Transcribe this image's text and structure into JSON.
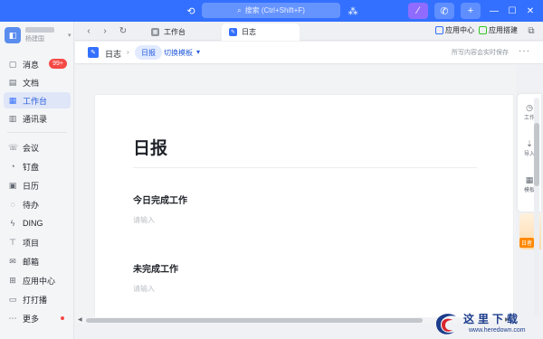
{
  "titlebar": {
    "search_placeholder": "搜索 (Ctrl+Shift+F)",
    "accent": "#3370ff",
    "icons": [
      "history-icon",
      "search-icon",
      "grid-apps-icon",
      "wand-icon",
      "phone-icon",
      "plus-icon",
      "minimize-icon",
      "maximize-icon",
      "close-icon"
    ]
  },
  "sidebar": {
    "user": {
      "org": "杨建国"
    },
    "items": [
      {
        "label": "消息",
        "icon": "chat-icon",
        "badge": "99+"
      },
      {
        "label": "文档",
        "icon": "document-icon"
      },
      {
        "label": "工作台",
        "icon": "workbench-icon",
        "active": true
      },
      {
        "label": "通讯录",
        "icon": "contacts-icon"
      },
      {
        "label": "会议",
        "icon": "meeting-icon"
      },
      {
        "label": "钉盘",
        "icon": "drive-icon"
      },
      {
        "label": "日历",
        "icon": "calendar-icon"
      },
      {
        "label": "待办",
        "icon": "todo-icon"
      },
      {
        "label": "DING",
        "icon": "ding-icon"
      },
      {
        "label": "项目",
        "icon": "project-icon"
      },
      {
        "label": "邮箱",
        "icon": "mail-icon"
      },
      {
        "label": "应用中心",
        "icon": "app-center-icon"
      },
      {
        "label": "打打播",
        "icon": "broadcast-icon"
      },
      {
        "label": "更多",
        "icon": "more-icon",
        "dot": true
      }
    ]
  },
  "tabs": [
    {
      "label": "工作台",
      "active": false
    },
    {
      "label": "日志",
      "active": true
    }
  ],
  "tabbar_right": {
    "app_center": "应用中心",
    "app_build": "应用搭建"
  },
  "doc": {
    "breadcrumb": "日志",
    "chip": "日报",
    "template_switch": "切换模板",
    "autosave": "所写内容会实时保存",
    "more": "···"
  },
  "paper": {
    "title": "日报",
    "sections": [
      {
        "heading": "今日完成工作",
        "placeholder": "请输入"
      },
      {
        "heading": "未完成工作",
        "placeholder": "请输入"
      }
    ]
  },
  "right_panel": {
    "items": [
      {
        "label": "工作",
        "icon": "clock-icon"
      },
      {
        "label": "导入",
        "icon": "import-icon"
      },
      {
        "label": "模板",
        "icon": "template-icon"
      }
    ],
    "promo_tag": "日者"
  },
  "watermark": {
    "title": "这里下载",
    "url": "www.heredown.com"
  }
}
